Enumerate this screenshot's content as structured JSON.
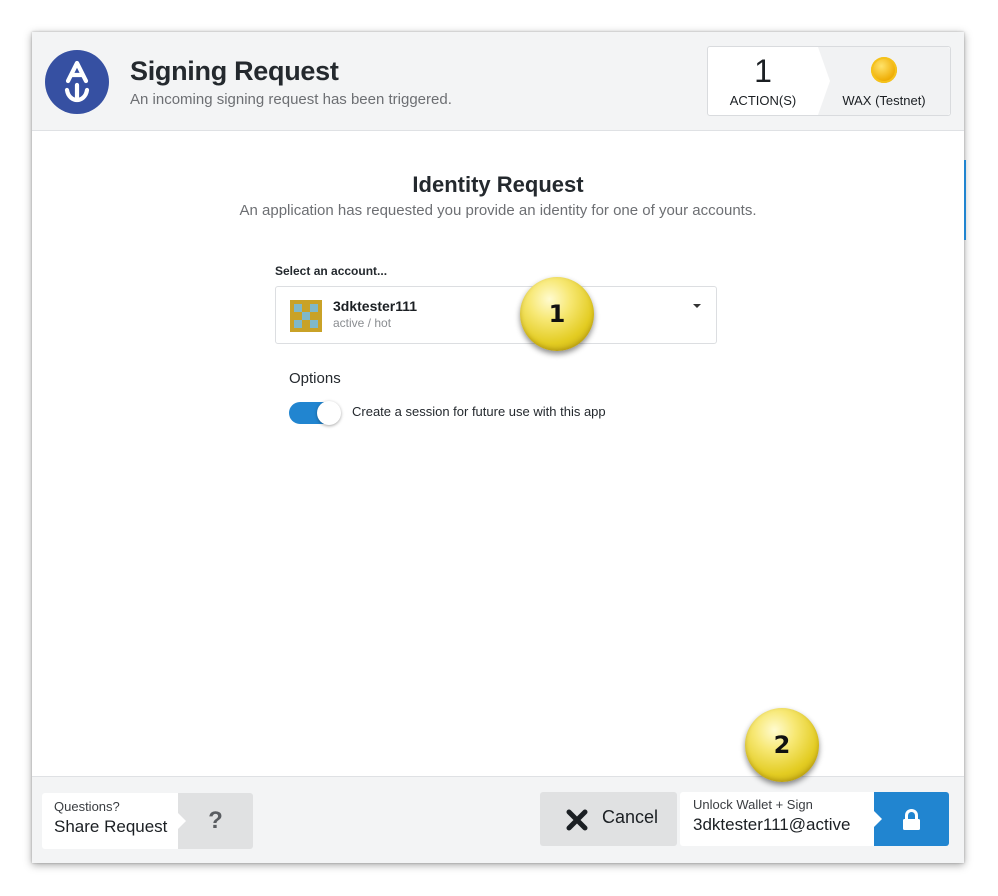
{
  "header": {
    "title": "Signing Request",
    "subtitle": "An incoming signing request has been triggered.",
    "action_count": "1",
    "action_label": "ACTION(S)",
    "chain_label": "WAX (Testnet)",
    "logo_icon": "anchor-logo-icon",
    "chain_icon": "wax-chain-icon"
  },
  "body": {
    "title": "Identity Request",
    "subtitle": "An application has requested you provide an identity for one of your accounts.",
    "select_label": "Select an account...",
    "account": {
      "name": "3dktester111",
      "permission": "active / hot"
    },
    "options_label": "Options",
    "session_toggle": {
      "label": "Create a session for future use with this app",
      "checked": true
    }
  },
  "footer": {
    "share_small": "Questions?",
    "share_big": "Share Request",
    "help_symbol": "?",
    "cancel_label": "Cancel",
    "sign_small": "Unlock Wallet + Sign",
    "sign_big": "3dktester111@active"
  },
  "callouts": [
    "1",
    "2"
  ],
  "colors": {
    "accent": "#2185d0",
    "logo": "#3650a2",
    "header_bg": "#f3f4f5",
    "callout": "#e3cc22"
  }
}
